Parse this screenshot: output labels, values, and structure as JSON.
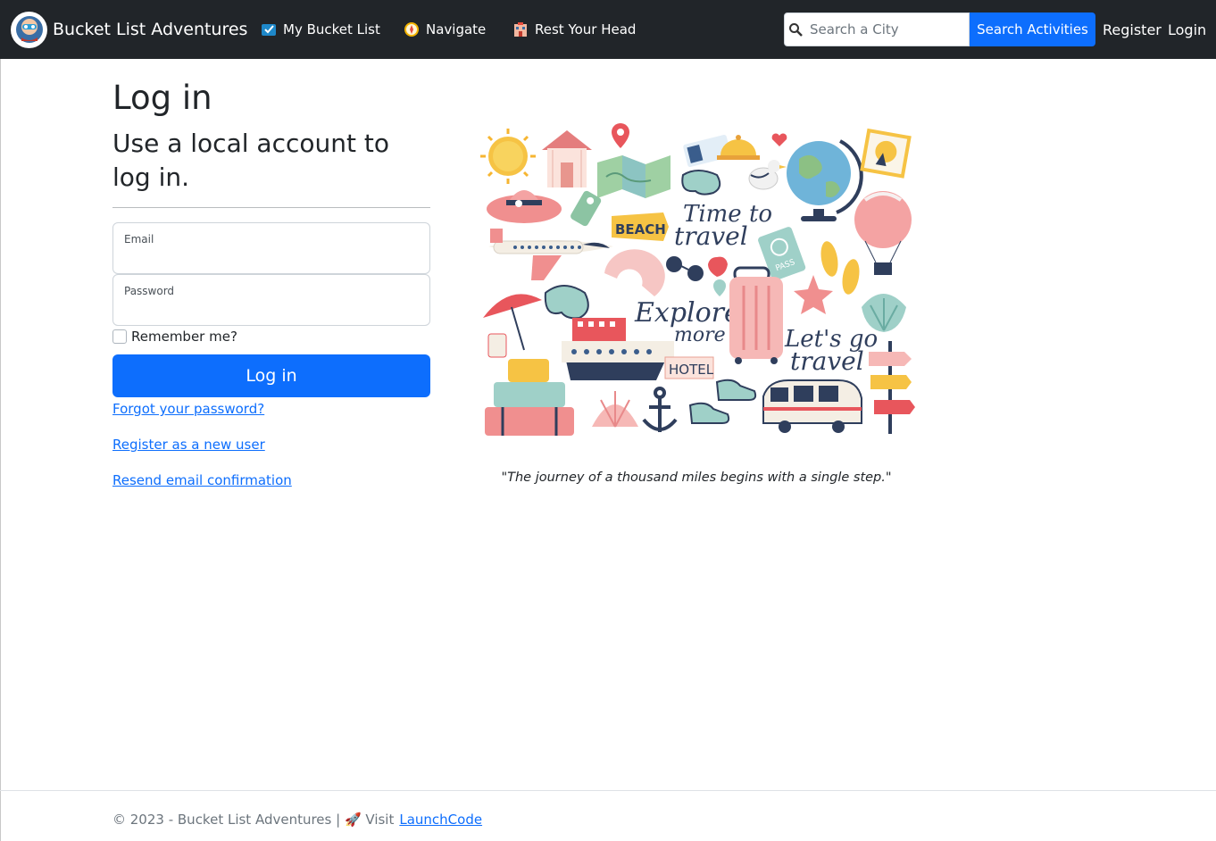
{
  "navbar": {
    "brand": "Bucket List Adventures",
    "items": [
      {
        "label": "My Bucket List",
        "icon": "checkmark-icon"
      },
      {
        "label": "Navigate",
        "icon": "compass-icon"
      },
      {
        "label": "Rest Your Head",
        "icon": "hotel-icon"
      }
    ],
    "search_placeholder": "Search a City",
    "search_button": "Search Activities",
    "register": "Register",
    "login": "Login"
  },
  "main": {
    "title": "Log in",
    "subtitle": "Use a local account to log in.",
    "email_label": "Email",
    "password_label": "Password",
    "remember_label": "Remember me?",
    "login_button": "Log in",
    "forgot_link": "Forgot your password?",
    "register_link": "Register as a new user",
    "resend_link": "Resend email confirmation"
  },
  "illustration": {
    "beach": "BEACH",
    "time1": "Time to",
    "time2": "travel",
    "explore1": "Explore",
    "explore2": "more",
    "hotel": "HOTEL",
    "lets1": "Let's go",
    "lets2": "travel",
    "pass": "PASS"
  },
  "quote": "\"The journey of a thousand miles begins with a single step.\"",
  "footer": {
    "text": "© 2023 - Bucket List Adventures | 🚀 Visit",
    "link": "LaunchCode"
  },
  "colors": {
    "navbar": "#212529",
    "primary": "#0d6efd"
  }
}
